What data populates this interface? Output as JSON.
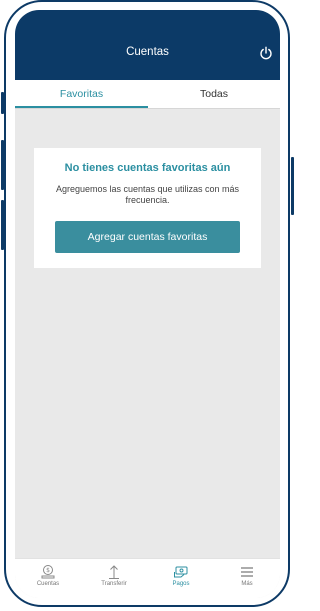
{
  "header": {
    "title": "Cuentas",
    "power_icon": "power-icon",
    "background_color": "#0c3a67"
  },
  "tabs": [
    {
      "label": "Favoritas",
      "selected": true
    },
    {
      "label": "Todas",
      "selected": false
    }
  ],
  "empty_state": {
    "title": "No tienes cuentas favoritas aún",
    "message": "Agreguemos las cuentas que utilizas con más frecuencia.",
    "button_label": "Agregar cuentas favoritas"
  },
  "bottom_nav": [
    {
      "label": "Cuentas",
      "icon": "bank-account-icon",
      "active": false
    },
    {
      "label": "Transferir",
      "icon": "transfer-icon",
      "active": false
    },
    {
      "label": "Pagos",
      "icon": "payments-icon",
      "active": true
    },
    {
      "label": "Más",
      "icon": "menu-icon",
      "active": false
    }
  ],
  "colors": {
    "accent": "#2b8fa1",
    "button": "#3a8e9e",
    "background": "#e9e9e9"
  }
}
